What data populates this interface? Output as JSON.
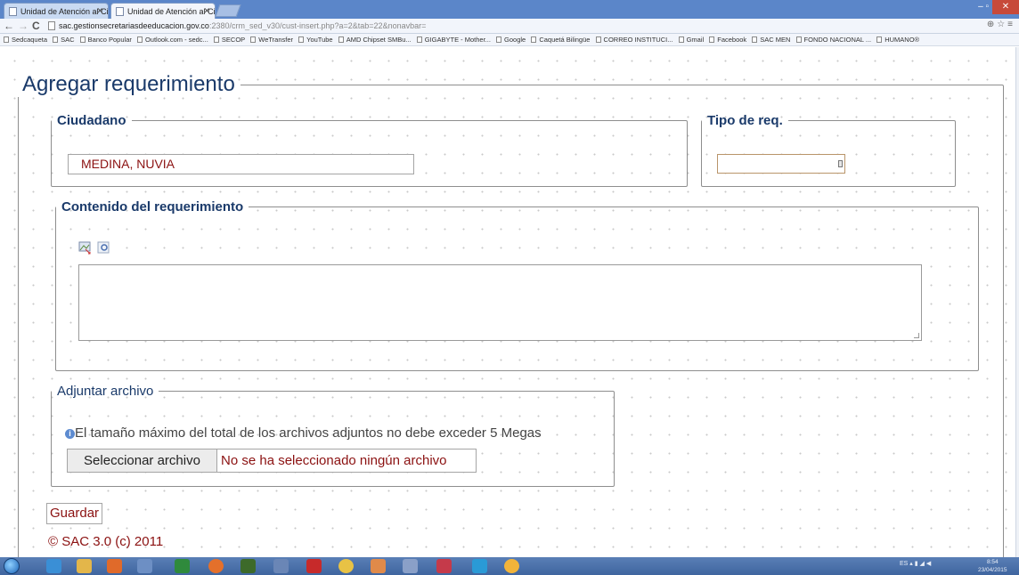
{
  "browser": {
    "tabs": [
      {
        "title": "Unidad de Atención al Ciu",
        "active": false
      },
      {
        "title": "Unidad de Atención al Ciu",
        "active": true
      }
    ],
    "url_host": "sac.gestionsecretariasdeeducacion.gov.co",
    "url_rest": ":2380/crm_sed_v30/cust-insert.php?a=2&tab=22&nonavbar=",
    "bookmarks": [
      "Sedcaqueta",
      "SAC",
      "Banco Popular",
      "Outlook.com - sedc...",
      "SECOP",
      "WeTransfer",
      "YouTube",
      "AMD Chipset SMBu...",
      "GIGABYTE - Mother...",
      "Google",
      "Caquetá Bilingüe",
      "CORREO INSTITUCI...",
      "Gmail",
      "Facebook",
      "SAC MEN",
      "FONDO NACIONAL ...",
      "HUMANO®"
    ]
  },
  "form": {
    "title": "Agregar requerimiento",
    "ciudadano": {
      "legend": "Ciudadano",
      "value": "MEDINA, NUVIA"
    },
    "tipo": {
      "legend": "Tipo de req.",
      "value": ""
    },
    "contenido": {
      "legend": "Contenido del requerimiento",
      "value": ""
    },
    "adjuntar": {
      "legend": "Adjuntar archivo",
      "info": "El tamaño máximo del total de los archivos adjuntos no debe exceder 5 Megas",
      "button": "Seleccionar archivo",
      "status": "No se ha seleccionado ningún archivo"
    },
    "save_label": "Guardar",
    "footer": "© SAC 3.0 (c) 2011"
  },
  "taskbar": {
    "tray": "ES",
    "time": "8:54",
    "date": "23/04/2015"
  },
  "colors": {
    "accent_text": "#8b1111",
    "legend_text": "#1a3a6a",
    "titlebar": "#5b86c9"
  }
}
